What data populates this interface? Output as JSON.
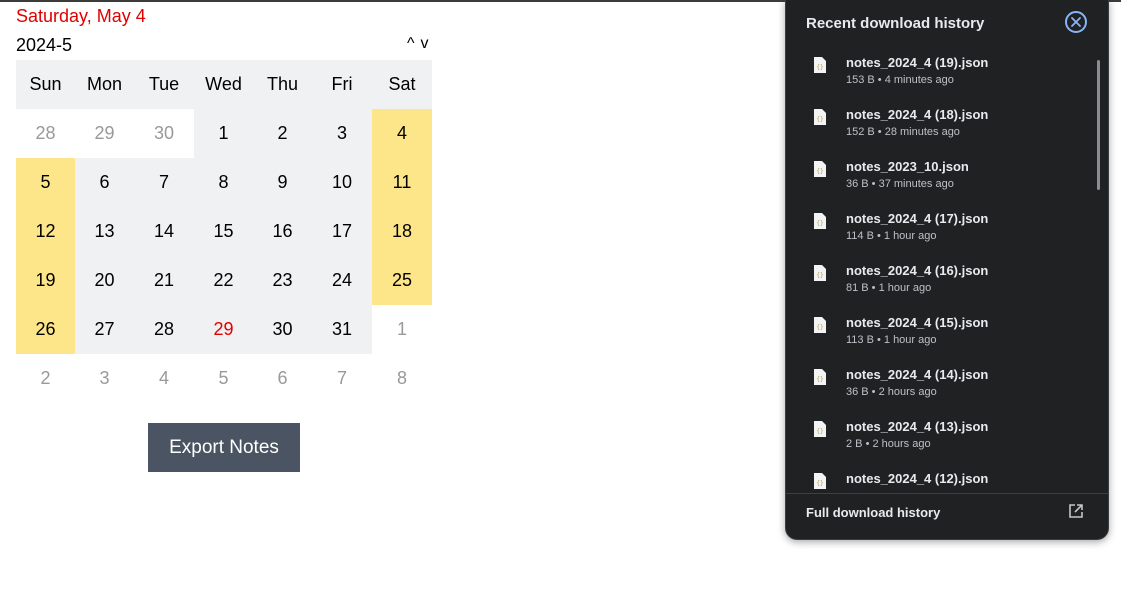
{
  "calendar": {
    "selected_date": "Saturday, May 4",
    "month_label": "2024-5",
    "nav_up": "^",
    "nav_down": "v",
    "weekdays": [
      "Sun",
      "Mon",
      "Tue",
      "Wed",
      "Thu",
      "Fri",
      "Sat"
    ],
    "days": [
      "28",
      "29",
      "30",
      "1",
      "2",
      "3",
      "4",
      "5",
      "6",
      "7",
      "8",
      "9",
      "10",
      "11",
      "12",
      "13",
      "14",
      "15",
      "16",
      "17",
      "18",
      "19",
      "20",
      "21",
      "22",
      "23",
      "24",
      "25",
      "26",
      "27",
      "28",
      "29",
      "30",
      "31",
      "1",
      "2",
      "3",
      "4",
      "5",
      "6",
      "7",
      "8"
    ],
    "export_label": "Export Notes"
  },
  "downloads": {
    "title": "Recent download history",
    "items": [
      {
        "name": "notes_2024_4 (19).json",
        "meta": "153 B • 4 minutes ago"
      },
      {
        "name": "notes_2024_4 (18).json",
        "meta": "152 B • 28 minutes ago"
      },
      {
        "name": "notes_2023_10.json",
        "meta": "36 B • 37 minutes ago"
      },
      {
        "name": "notes_2024_4 (17).json",
        "meta": "114 B • 1 hour ago"
      },
      {
        "name": "notes_2024_4 (16).json",
        "meta": "81 B • 1 hour ago"
      },
      {
        "name": "notes_2024_4 (15).json",
        "meta": "113 B • 1 hour ago"
      },
      {
        "name": "notes_2024_4 (14).json",
        "meta": "36 B • 2 hours ago"
      },
      {
        "name": "notes_2024_4 (13).json",
        "meta": "2 B • 2 hours ago"
      },
      {
        "name": "notes_2024_4 (12).json",
        "meta": ""
      }
    ],
    "footer_label": "Full download history"
  },
  "colors": {
    "accent_red": "#e00000",
    "weekend_highlight": "#fde68a",
    "note_dot": "#118a11",
    "panel_bg": "#1f2123"
  }
}
